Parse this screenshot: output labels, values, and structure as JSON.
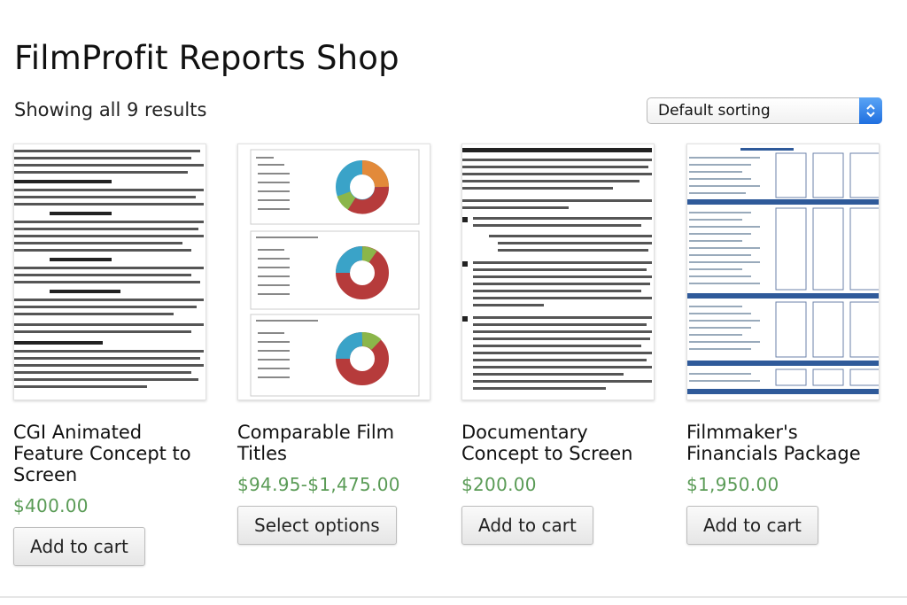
{
  "shop": {
    "title": "FilmProfit Reports Shop",
    "result_count": "Showing all 9 results",
    "sorting": {
      "selected": "Default sorting"
    }
  },
  "colors": {
    "price": "#5a9b56",
    "select_accent": "#2a7be8",
    "table_header": "#2f5a9a"
  },
  "products": [
    {
      "name": "CGI Animated Feature Concept to Screen",
      "price": "$400.00",
      "button": "Add to cart"
    },
    {
      "name": "Comparable Film Titles",
      "price": "$94.95-$1,475.00",
      "button": "Select options"
    },
    {
      "name": "Documentary Concept to Screen",
      "price": "$200.00",
      "button": "Add to cart"
    },
    {
      "name": "Filmmaker's Financials Package",
      "price": "$1,950.00",
      "button": "Add to cart"
    }
  ]
}
